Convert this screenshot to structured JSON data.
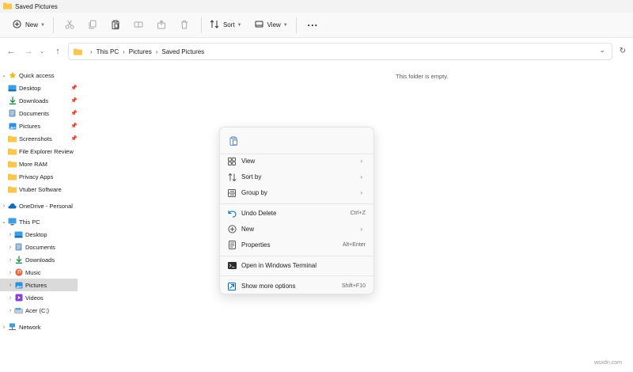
{
  "window": {
    "title": "Saved Pictures"
  },
  "toolbar": {
    "new_label": "New",
    "sort_label": "Sort",
    "view_label": "View",
    "icons": [
      "cut-icon",
      "copy-icon",
      "paste-icon",
      "rename-icon",
      "share-icon",
      "delete-icon"
    ]
  },
  "address": {
    "crumbs": [
      "This PC",
      "Pictures",
      "Saved Pictures"
    ]
  },
  "sidebar": {
    "quick_access": {
      "label": "Quick access",
      "items": [
        {
          "label": "Desktop",
          "icon": "desktop-icon",
          "pinned": true
        },
        {
          "label": "Downloads",
          "icon": "downloads-icon",
          "pinned": true
        },
        {
          "label": "Documents",
          "icon": "documents-icon",
          "pinned": true
        },
        {
          "label": "Pictures",
          "icon": "pictures-icon",
          "pinned": true
        },
        {
          "label": "Screenshots",
          "icon": "folder-icon",
          "pinned": true
        },
        {
          "label": "File Explorer Review",
          "icon": "folder-icon",
          "pinned": false
        },
        {
          "label": "More RAM",
          "icon": "folder-icon",
          "pinned": false
        },
        {
          "label": "Privacy Apps",
          "icon": "folder-icon",
          "pinned": false
        },
        {
          "label": "Vtuber Software",
          "icon": "folder-icon",
          "pinned": false
        }
      ]
    },
    "onedrive": {
      "label": "OneDrive - Personal"
    },
    "this_pc": {
      "label": "This PC",
      "items": [
        {
          "label": "Desktop",
          "icon": "desktop-icon"
        },
        {
          "label": "Documents",
          "icon": "documents-icon"
        },
        {
          "label": "Downloads",
          "icon": "downloads-icon"
        },
        {
          "label": "Music",
          "icon": "music-icon"
        },
        {
          "label": "Pictures",
          "icon": "pictures-icon",
          "selected": true
        },
        {
          "label": "Videos",
          "icon": "videos-icon"
        },
        {
          "label": "Acer (C:)",
          "icon": "drive-icon"
        }
      ]
    },
    "network": {
      "label": "Network"
    }
  },
  "main": {
    "empty_message": "This folder is empty."
  },
  "context_menu": {
    "items": [
      {
        "label": "View",
        "icon": "view-icon",
        "submenu": true,
        "shortcut": ""
      },
      {
        "label": "Sort by",
        "icon": "sort-icon",
        "submenu": true,
        "shortcut": ""
      },
      {
        "label": "Group by",
        "icon": "group-icon",
        "submenu": true,
        "shortcut": ""
      },
      {
        "label": "Undo Delete",
        "icon": "undo-icon",
        "submenu": false,
        "shortcut": "Ctrl+Z"
      },
      {
        "label": "New",
        "icon": "new-icon",
        "submenu": true,
        "shortcut": ""
      },
      {
        "label": "Properties",
        "icon": "properties-icon",
        "submenu": false,
        "shortcut": "Alt+Enter"
      },
      {
        "label": "Open in Windows Terminal",
        "icon": "terminal-icon",
        "submenu": false,
        "shortcut": ""
      },
      {
        "label": "Show more options",
        "icon": "more-options-icon",
        "submenu": false,
        "shortcut": "Shift+F10"
      }
    ]
  },
  "watermark": "wsxdn.com",
  "colors": {
    "accent": "#0067c0",
    "folder": "#f7c64c",
    "selection": "#dadada"
  }
}
